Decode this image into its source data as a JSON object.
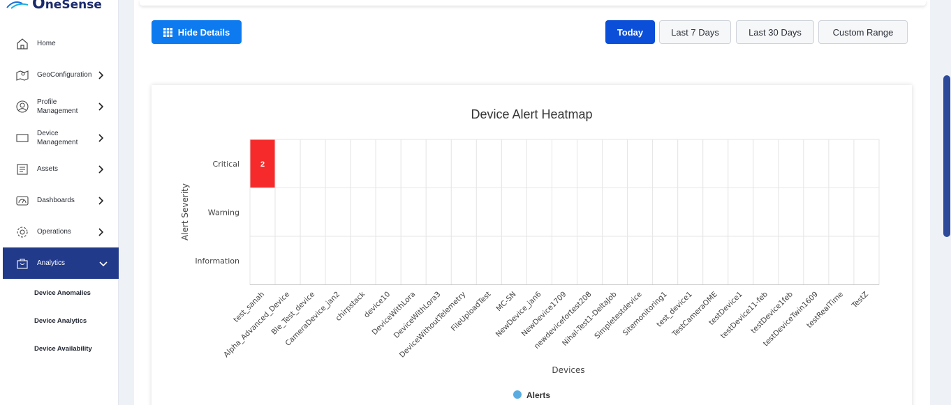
{
  "brand": {
    "name": "neSense"
  },
  "sidebar": {
    "items": [
      {
        "label": "Home",
        "icon": "home-icon",
        "chevron": false
      },
      {
        "label": "GeoConfiguration",
        "icon": "map-icon",
        "chevron": true
      },
      {
        "label": "Profile Management",
        "icon": "user-circle-icon",
        "chevron": true
      },
      {
        "label": "Device Management",
        "icon": "laptop-icon",
        "chevron": true
      },
      {
        "label": "Assets",
        "icon": "assets-icon",
        "chevron": true
      },
      {
        "label": "Dashboards",
        "icon": "dashboard-icon",
        "chevron": true
      },
      {
        "label": "Operations",
        "icon": "gear-icon",
        "chevron": true
      },
      {
        "label": "Analytics",
        "icon": "bag-icon",
        "chevron": true,
        "active": true
      }
    ],
    "subitems": [
      {
        "label": "Device Anomalies"
      },
      {
        "label": "Device Analytics"
      },
      {
        "label": "Device Availability"
      }
    ]
  },
  "toolbar": {
    "hide_details": "Hide Details",
    "ranges": [
      "Today",
      "Last 7 Days",
      "Last 30 Days",
      "Custom Range"
    ],
    "active_range": "Today"
  },
  "colors": {
    "primary": "#0d7bef",
    "active_range": "#0b4fd8",
    "sidebar_active": "#223a8a",
    "critical": "#f62a2a",
    "legend": "#5aace0"
  },
  "chart_data": {
    "type": "heatmap",
    "title": "Device Alert Heatmap",
    "xlabel": "Devices",
    "ylabel": "Alert Severity",
    "y": [
      "Critical",
      "Warning",
      "Information"
    ],
    "x": [
      "test_sanah",
      "Alpha_Advanced_Device",
      "Ble_Test_device",
      "CameraDevice_jan2",
      "chirpstack",
      "device10",
      "DeviceWithLora",
      "DeviceWithLora3",
      "DeviceWithoutTelemetry",
      "FileUploadTest",
      "MC-SN",
      "NewDevice_jan6",
      "NewDevice1709",
      "newdevicefortest208",
      "Nihal-Test1-DeltaJob",
      "Simpletestdevice",
      "Sitemonitoring1",
      "test_device1",
      "TestCameraOME",
      "testDevice1",
      "testDevice11-feb",
      "testDevice1feb",
      "testDeviceTwin1609",
      "testRealTime",
      "TestZ"
    ],
    "cells": [
      {
        "x": "test_sanah",
        "y": "Critical",
        "value": 2
      }
    ],
    "legend": [
      {
        "name": "Alerts"
      }
    ]
  }
}
